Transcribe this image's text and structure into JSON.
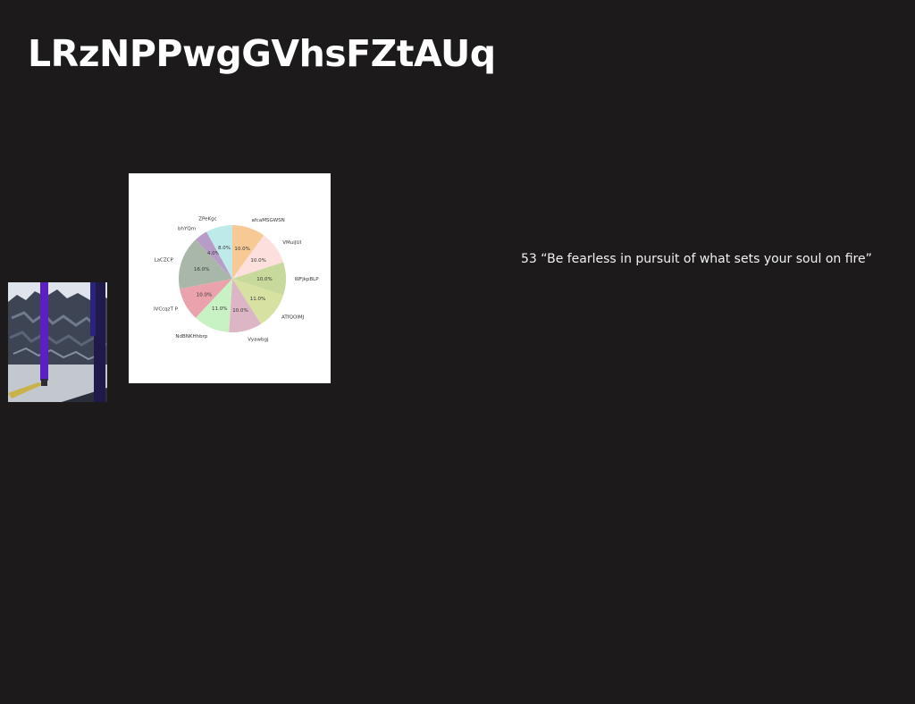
{
  "page": {
    "title": "LRzNPPwgGVhsFZtAUq"
  },
  "quote": {
    "text": "53 “Be fearless in pursuit of what sets your soul on fire”"
  },
  "photo": {
    "description_icon": "street-photo-image"
  },
  "chart_data": {
    "type": "pie",
    "slices": [
      {
        "label": "afcaMSGWSN",
        "value": 10.0,
        "pct_label": "10.0%",
        "color": "#f6c995"
      },
      {
        "label": "VMuiJUI",
        "value": 10.0,
        "pct_label": "10.0%",
        "color": "#fde0dd"
      },
      {
        "label": "WFjkpBLP",
        "value": 10.0,
        "pct_label": "10.0%",
        "color": "#c7d99b"
      },
      {
        "label": "ATfQOIMJ",
        "value": 11.0,
        "pct_label": "11.0%",
        "color": "#d7e2a2"
      },
      {
        "label": "Vyawbgj",
        "value": 10.0,
        "pct_label": "10.0%",
        "color": "#dcb6c4"
      },
      {
        "label": "NdBNKHhbrp",
        "value": 11.0,
        "pct_label": "11.0%",
        "color": "#c9f2c4"
      },
      {
        "label": "IVCcqzT P",
        "value": 10.0,
        "pct_label": "10.0%",
        "color": "#eaa2ad"
      },
      {
        "label": "LaCZCP",
        "value": 16.0,
        "pct_label": "16.0%",
        "color": "#a9b7a9"
      },
      {
        "label": "bhYQm",
        "value": 4.0,
        "pct_label": "4.0%",
        "color": "#b79cc8"
      },
      {
        "label": "ZPeKgc",
        "value": 8.0,
        "pct_label": "8.0%",
        "color": "#bfeaea"
      }
    ]
  }
}
